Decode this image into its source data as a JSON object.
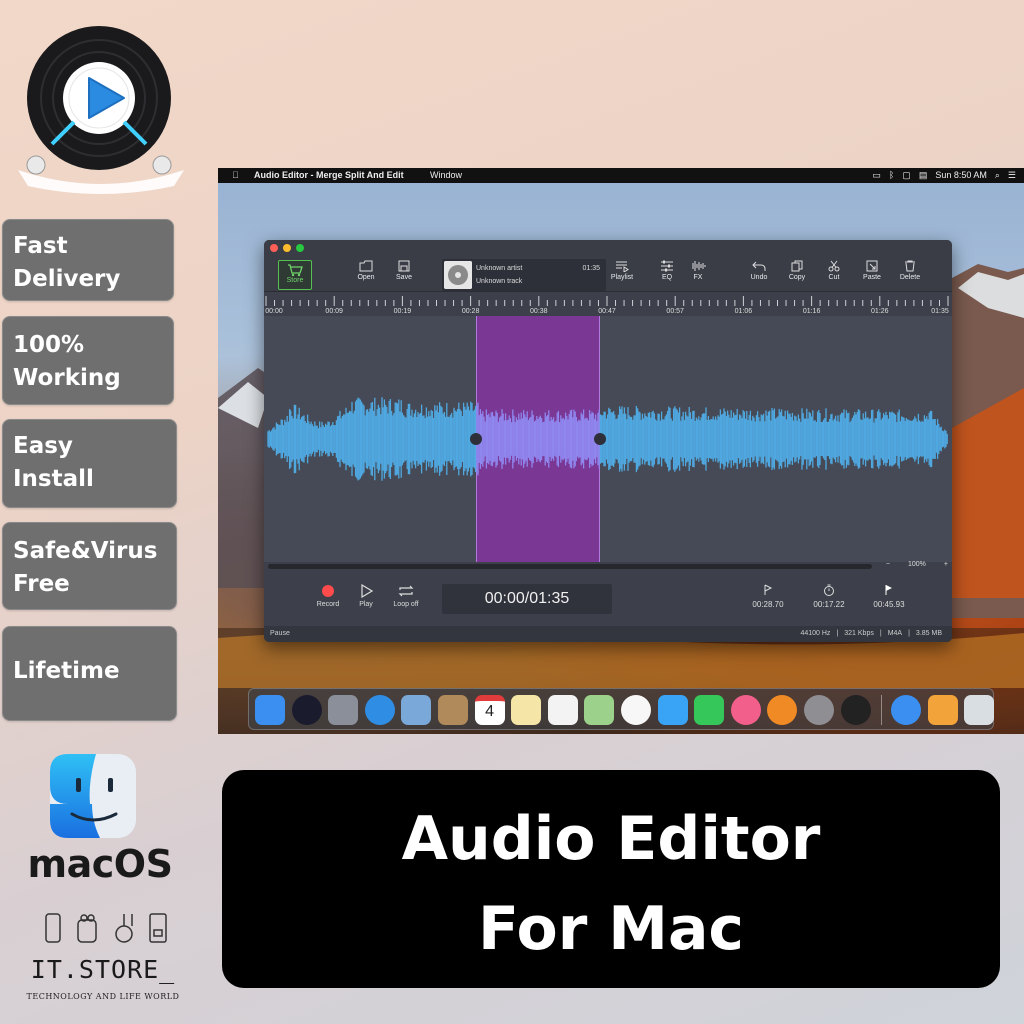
{
  "features": [
    {
      "lines": [
        "Fast",
        "Delivery"
      ]
    },
    {
      "lines": [
        "100%",
        "Working"
      ]
    },
    {
      "lines": [
        "Easy",
        "Install"
      ]
    },
    {
      "lines": [
        "Safe&Virus",
        "Free"
      ]
    },
    {
      "lines": [
        "Lifetime"
      ]
    }
  ],
  "brand": {
    "os_label": "macOS",
    "store_name": "IT.STORE_",
    "store_tagline": "TECHNOLOGY AND LIFE WORLD",
    "logo_icon": "vinyl-play-icon",
    "os_icon": "finder-icon"
  },
  "menubar": {
    "apple": "",
    "app_name": "Audio Editor - Merge Split And Edit",
    "menu_window": "Window",
    "clock": "Sun 8:50 AM",
    "icons": [
      "airplay-icon",
      "bluetooth-icon",
      "display-icon",
      "flag-icon",
      "search-icon",
      "list-icon"
    ]
  },
  "toolbar": {
    "store": "Store",
    "open": "Open",
    "save": "Save",
    "playlist": "Playlist",
    "eq": "EQ",
    "fx": "FX",
    "undo": "Undo",
    "copy": "Copy",
    "cut": "Cut",
    "paste": "Paste",
    "delete": "Delete"
  },
  "track": {
    "artist": "Unknown artist",
    "title": "Unknown track",
    "duration": "01:35"
  },
  "ruler": [
    "00:00",
    "00:09",
    "00:19",
    "00:28",
    "00:38",
    "00:47",
    "00:57",
    "01:06",
    "01:16",
    "01:26",
    "01:35"
  ],
  "selection": {
    "start": "00:28.70",
    "end": "00:45.93",
    "duration": "00:17.22"
  },
  "zoom": {
    "minus": "−",
    "value": "100%",
    "plus": "+"
  },
  "transport": {
    "record": "Record",
    "play": "Play",
    "loop": "Loop off",
    "time": "00:00/01:35",
    "start_marker": "00:28.70",
    "length_marker": "00:17.22",
    "end_marker": "00:45.93"
  },
  "status": {
    "state": "Pause",
    "sample_rate": "44100 Hz",
    "bitrate": "321 Kbps",
    "format": "M4A",
    "size": "3.85 MB"
  },
  "dock": [
    "finder-icon",
    "siri-icon",
    "launchpad-icon",
    "safari-icon",
    "mail-icon",
    "contacts-icon",
    "calendar-icon",
    "notes-icon",
    "reminders-icon",
    "maps-icon",
    "photos-icon",
    "messages-icon",
    "facetime-icon",
    "itunes-icon",
    "ibooks-icon",
    "system-preferences-icon",
    "audio-editor-icon",
    "downloads-icon",
    "stacks-icon",
    "trash-icon"
  ],
  "calendar_day": "4",
  "colors": {
    "waveform": "#4fa8e0",
    "selection": "#8c32aa",
    "tile": "#6f6f70",
    "banner": "#000000"
  },
  "title": {
    "line1": "Audio Editor",
    "line2": "For Mac"
  }
}
